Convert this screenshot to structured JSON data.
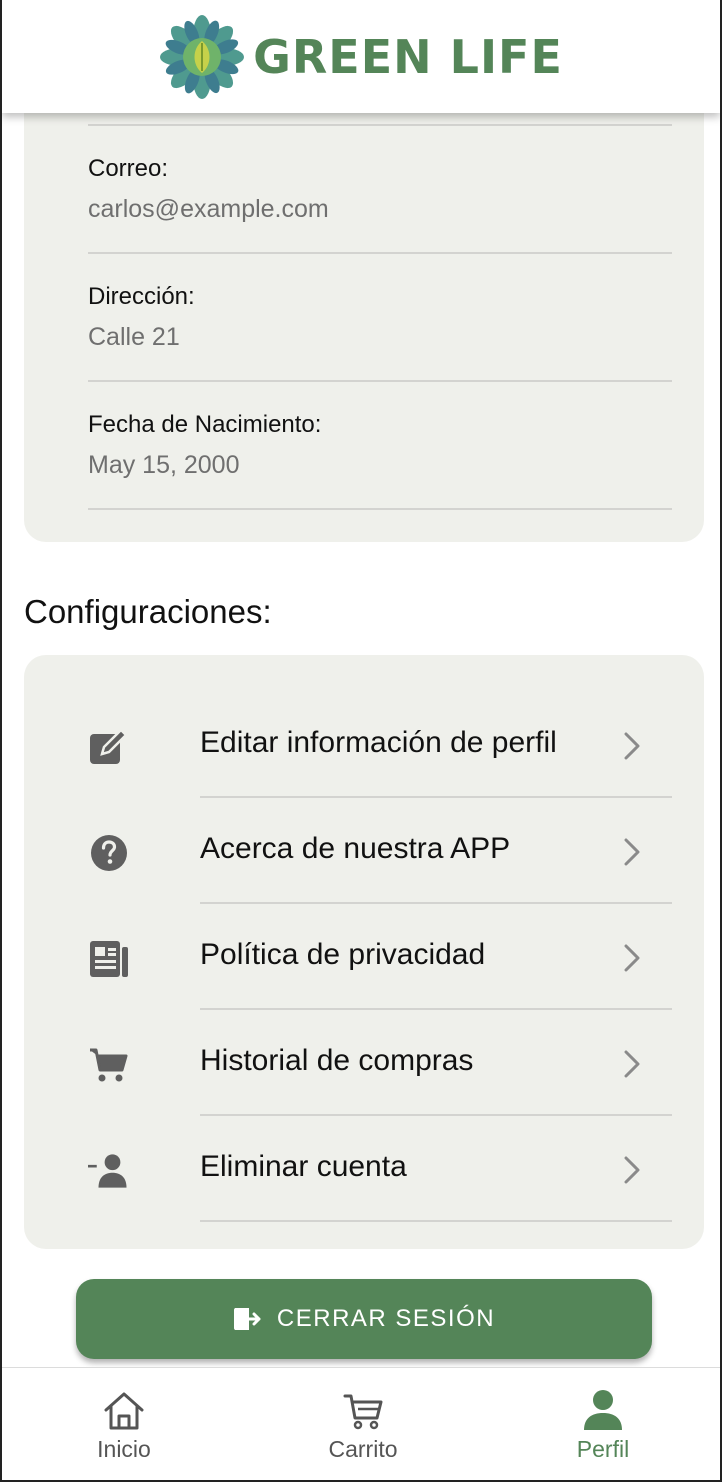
{
  "header": {
    "brand": "GREEN LIFE",
    "logo_icon": "leaf-mandala-logo"
  },
  "profile": {
    "fields": [
      {
        "label": "Correo:",
        "value": "carlos@example.com"
      },
      {
        "label": "Dirección:",
        "value": "Calle 21"
      },
      {
        "label": "Fecha de Nacimiento:",
        "value": "May 15, 2000"
      }
    ]
  },
  "settings": {
    "title": "Configuraciones:",
    "items": [
      {
        "label": "Editar información de perfil",
        "icon": "edit-icon"
      },
      {
        "label": "Acerca de nuestra APP",
        "icon": "help-icon"
      },
      {
        "label": "Política de privacidad",
        "icon": "document-icon"
      },
      {
        "label": "Historial de compras",
        "icon": "cart-icon"
      },
      {
        "label": "Eliminar cuenta",
        "icon": "remove-user-icon"
      }
    ]
  },
  "logout": {
    "label": "CERRAR SESIÓN",
    "icon": "logout-icon"
  },
  "nav": {
    "items": [
      {
        "label": "Inicio",
        "icon": "home-icon"
      },
      {
        "label": "Carrito",
        "icon": "cart-icon"
      },
      {
        "label": "Perfil",
        "icon": "person-icon",
        "active": true
      }
    ]
  },
  "colors": {
    "accent": "#548558",
    "card_bg": "#eff0eb",
    "icon_gray": "#5f5f5f"
  }
}
